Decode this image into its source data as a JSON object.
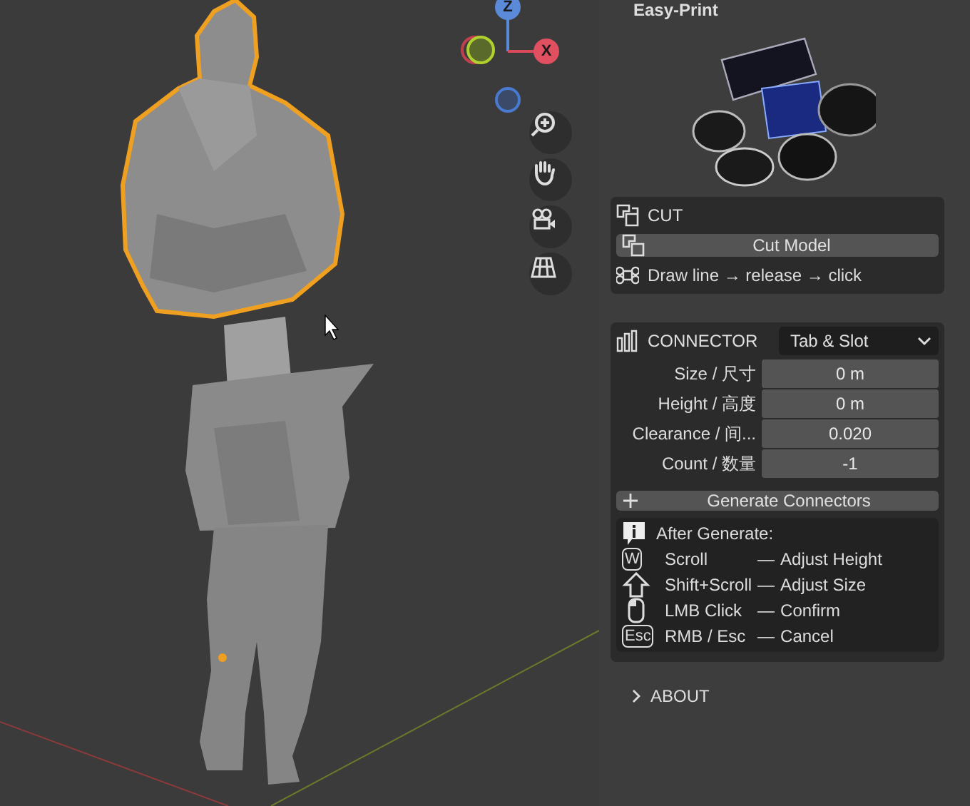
{
  "panel": {
    "title": "Easy-Print"
  },
  "cut": {
    "title": "CUT",
    "button": "Cut Model",
    "hint": "Draw line → release → click"
  },
  "connector": {
    "title": "CONNECTOR",
    "type": "Tab & Slot",
    "fields": [
      {
        "label": "Size / 尺寸",
        "value": "0 m"
      },
      {
        "label": "Height / 高度",
        "value": "0 m"
      },
      {
        "label": "Clearance / 间...",
        "value": "0.020"
      },
      {
        "label": "Count / 数量",
        "value": "-1"
      }
    ],
    "button": "Generate Connectors"
  },
  "help": {
    "title": "After Generate:",
    "rows": [
      {
        "kind": "key",
        "key": "W",
        "input": "Scroll",
        "dash": "—",
        "action": "Adjust Height"
      },
      {
        "kind": "shift",
        "input": "Shift+Scroll",
        "dash": "—",
        "action": "Adjust Size"
      },
      {
        "kind": "mouse",
        "input": "LMB Click",
        "dash": "—",
        "action": "Confirm"
      },
      {
        "kind": "key",
        "key": "Esc",
        "input": "RMB / Esc",
        "dash": "—",
        "action": "Cancel"
      }
    ]
  },
  "about": {
    "label": "ABOUT",
    "expanded": false
  },
  "gizmo": {
    "z": "Z",
    "x": "X"
  }
}
